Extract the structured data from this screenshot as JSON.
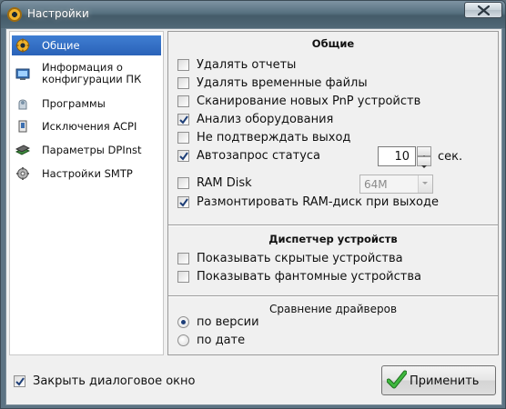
{
  "window": {
    "title": "Настройки"
  },
  "sidebar": {
    "items": [
      {
        "label": "Общие",
        "icon": "gear-icon",
        "selected": true
      },
      {
        "label": "Информация о\nконфигурации ПК",
        "icon": "computer-info-icon",
        "selected": false
      },
      {
        "label": "Программы",
        "icon": "programs-icon",
        "selected": false
      },
      {
        "label": "Исключения ACPI",
        "icon": "acpi-icon",
        "selected": false
      },
      {
        "label": "Параметры DPInst",
        "icon": "dpinst-icon",
        "selected": false
      },
      {
        "label": "Настройки SMTP",
        "icon": "smtp-gear-icon",
        "selected": false
      }
    ]
  },
  "general": {
    "title": "Общие",
    "options": [
      {
        "label": "Удалять отчеты",
        "checked": false
      },
      {
        "label": "Удалять временные файлы",
        "checked": false
      },
      {
        "label": "Сканирование новых PnP устройств",
        "checked": false
      },
      {
        "label": "Анализ оборудования",
        "checked": true
      },
      {
        "label": "Не подтверждать выход",
        "checked": false
      },
      {
        "label": "Автозапрос статуса",
        "checked": true
      },
      {
        "label": "RAM Disk",
        "checked": false
      },
      {
        "label": "Размонтировать RAM-диск при выходе",
        "checked": true
      }
    ],
    "status_interval": "10",
    "status_unit": "сек.",
    "ram_size": "64M"
  },
  "device_manager": {
    "title": "Диспетчер устройств",
    "options": [
      {
        "label": "Показывать скрытые устройства",
        "checked": false
      },
      {
        "label": "Показывать фантомные устройства",
        "checked": false
      }
    ]
  },
  "driver_compare": {
    "title": "Сравнение драйверов",
    "options": [
      {
        "label": "по версии",
        "selected": true
      },
      {
        "label": "по дате",
        "selected": false
      }
    ]
  },
  "footer": {
    "close_dialog_label": "Закрыть диалоговое окно",
    "close_dialog_checked": true,
    "apply_label": "Применить"
  },
  "colors": {
    "selection": "#2a62b8",
    "titlebar": "#4d6372",
    "check_green": "#2e9b2e"
  }
}
